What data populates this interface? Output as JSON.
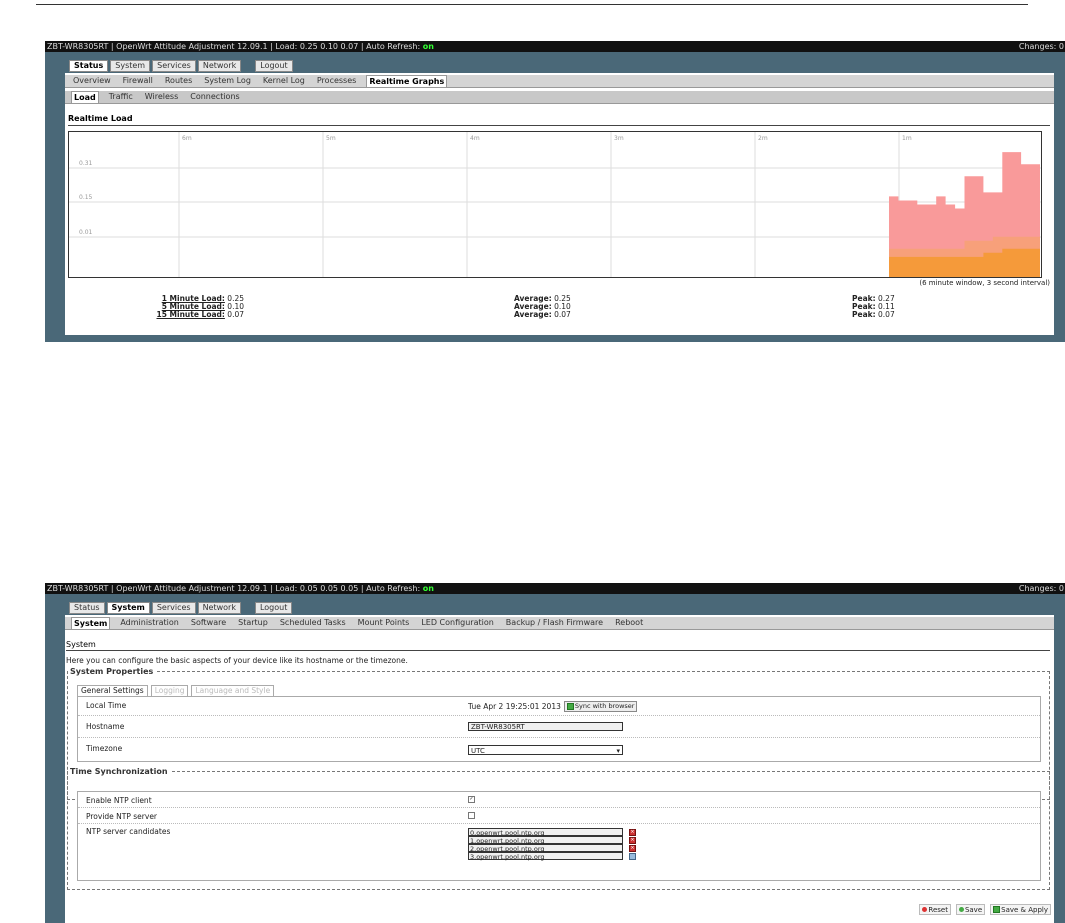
{
  "shot1": {
    "sysbar": {
      "text": "ZBT-WR8305RT | OpenWrt Attitude Adjustment 12.09.1 | Load: 0.25 0.10 0.07 | Auto Refresh: ",
      "refresh_state": "on",
      "changes": "Changes: 0"
    },
    "main_tabs": [
      "Status",
      "System",
      "Services",
      "Network",
      "Logout"
    ],
    "active_main_tab": "Status",
    "status_tabs": [
      "Overview",
      "Firewall",
      "Routes",
      "System Log",
      "Kernel Log",
      "Processes",
      "Realtime Graphs"
    ],
    "active_status_tab": "Realtime Graphs",
    "graph_tabs": [
      "Load",
      "Traffic",
      "Wireless",
      "Connections"
    ],
    "active_graph_tab": "Load",
    "section_title": "Realtime Load",
    "window_info": "(6 minute window, 3 second interval)",
    "stats": [
      {
        "label": "1 Minute Load:",
        "value": "0.25",
        "avg_label": "Average:",
        "avg": "0.25",
        "peak_label": "Peak:",
        "peak": "0.27"
      },
      {
        "label": "5 Minute Load:",
        "value": "0.10",
        "avg_label": "Average:",
        "avg": "0.10",
        "peak_label": "Peak:",
        "peak": "0.11"
      },
      {
        "label": "15 Minute Load:",
        "value": "0.07",
        "avg_label": "Average:",
        "avg": "0.07",
        "peak_label": "Peak:",
        "peak": "0.07"
      }
    ]
  },
  "chart_data": {
    "type": "area",
    "x_ticks": [
      "6m",
      "5m",
      "4m",
      "3m",
      "2m",
      "1m"
    ],
    "y_ticks": [
      "0.31",
      "0.15",
      "0.01"
    ],
    "ylim": [
      0,
      0.36
    ],
    "series": [
      {
        "name": "1 Minute Load",
        "color": "#f99a9a",
        "values": [
          0.2,
          0.19,
          0.19,
          0.18,
          0.18,
          0.2,
          0.18,
          0.17,
          0.25,
          0.25,
          0.21,
          0.21,
          0.31,
          0.31,
          0.28,
          0.28
        ]
      },
      {
        "name": "5 Minute Load",
        "color": "#f7a07a",
        "values": [
          0.07,
          0.07,
          0.07,
          0.07,
          0.07,
          0.07,
          0.07,
          0.07,
          0.09,
          0.09,
          0.09,
          0.1,
          0.1,
          0.1,
          0.1,
          0.1
        ]
      },
      {
        "name": "15 Minute Load",
        "color": "#f59a3a",
        "values": [
          0.05,
          0.05,
          0.05,
          0.05,
          0.05,
          0.05,
          0.05,
          0.05,
          0.05,
          0.05,
          0.06,
          0.06,
          0.07,
          0.07,
          0.07,
          0.07
        ]
      }
    ]
  },
  "shot2": {
    "sysbar": {
      "text": "ZBT-WR8305RT | OpenWrt Attitude Adjustment 12.09.1 | Load: 0.05 0.05 0.05 | Auto Refresh: ",
      "refresh_state": "on",
      "changes": "Changes: 0"
    },
    "main_tabs": [
      "Status",
      "System",
      "Services",
      "Network",
      "Logout"
    ],
    "active_main_tab": "System",
    "system_tabs": [
      "System",
      "Administration",
      "Software",
      "Startup",
      "Scheduled Tasks",
      "Mount Points",
      "LED Configuration",
      "Backup / Flash Firmware",
      "Reboot"
    ],
    "active_system_tab": "System",
    "section_title": "System",
    "description": "Here you can configure the basic aspects of your device like its hostname or the timezone.",
    "props_legend": "System Properties",
    "sub_tabs": [
      "General Settings",
      "Logging",
      "Language and Style"
    ],
    "local_time_label": "Local Time",
    "local_time_value": "Tue Apr 2 19:25:01 2013",
    "sync_button": "Sync with browser",
    "hostname_label": "Hostname",
    "hostname_value": "ZBT-WR8305RT",
    "timezone_label": "Timezone",
    "timezone_value": "UTC",
    "ntp_legend": "Time Synchronization",
    "enable_ntp_label": "Enable NTP client",
    "provide_ntp_label": "Provide NTP server",
    "ntp_candidates_label": "NTP server candidates",
    "ntp_servers": [
      "0.openwrt.pool.ntp.org",
      "1.openwrt.pool.ntp.org",
      "2.openwrt.pool.ntp.org",
      "3.openwrt.pool.ntp.org"
    ],
    "footer": {
      "reset": "Reset",
      "save": "Save",
      "save_apply": "Save & Apply"
    }
  }
}
